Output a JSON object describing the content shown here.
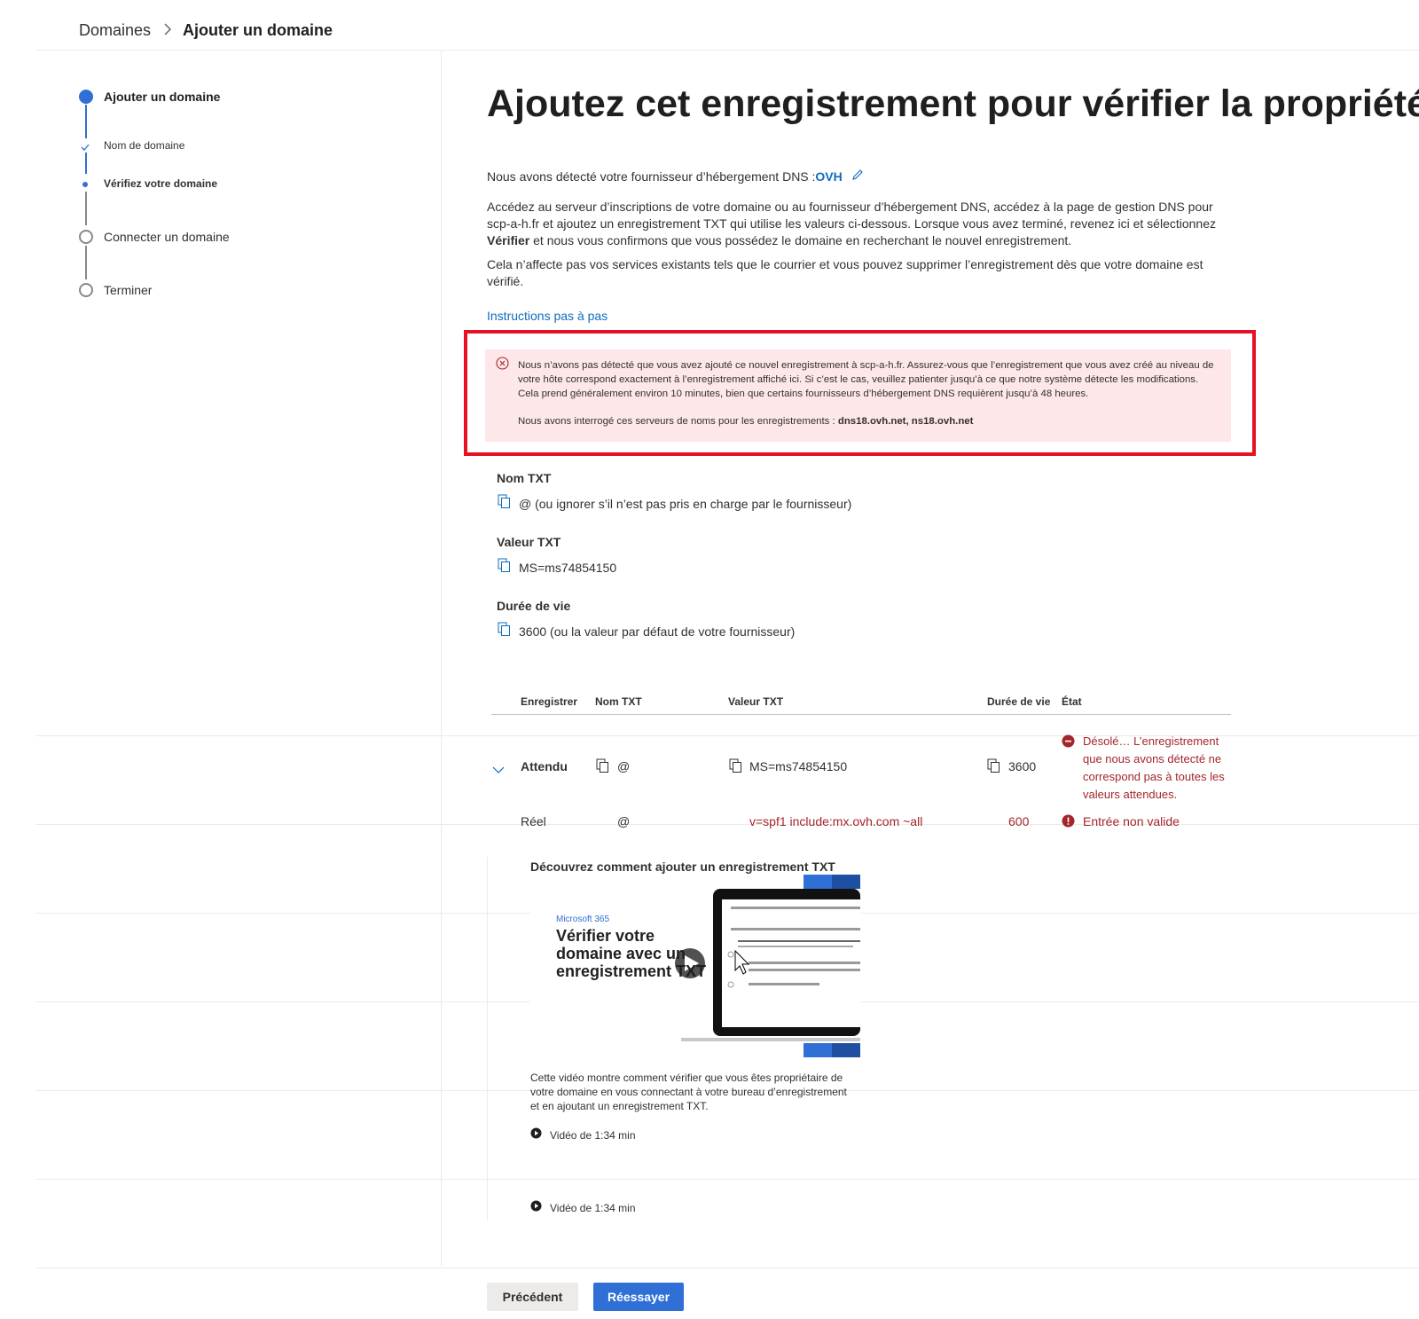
{
  "breadcrumb": {
    "root": "Domaines",
    "current": "Ajouter un domaine"
  },
  "stepper": {
    "step1": "Ajouter un domaine",
    "sub1": "Nom de domaine",
    "sub2": "Vérifiez votre domaine",
    "step2": "Connecter un domaine",
    "step3": "Terminer"
  },
  "page": {
    "title": "Ajoutez cet enregistrement pour vérifier la propriété",
    "detected_prefix": "Nous avons détecté votre fournisseur d’hébergement DNS : ",
    "provider": "OVH",
    "para1_a": "Accédez au serveur d’inscriptions de votre domaine ou au fournisseur d’hébergement DNS, accédez à la page de gestion DNS pour scp-a-h.fr et ajoutez un enregistrement TXT qui utilise les valeurs ci-dessous. Lorsque vous avez terminé, revenez ici et sélectionnez ",
    "para1_b": "Vérifier",
    "para1_c": " et nous vous confirmons que vous possédez le domaine en recherchant le nouvel enregistrement.",
    "para2": "Cela n’affecte pas vos services existants tels que le courrier et vous pouvez supprimer l’enregistrement dès que votre domaine est vérifié.",
    "instructions_link": "Instructions pas à pas"
  },
  "error": {
    "message": "Nous n’avons pas détecté que vous avez ajouté ce nouvel enregistrement à scp-a-h.fr. Assurez-vous que l’enregistrement que vous avez créé au niveau de votre hôte correspond exactement à l’enregistrement affiché ici. Si c’est le cas, veuillez patienter jusqu’à ce que notre système détecte les modifications. Cela prend généralement environ 10 minutes, bien que certains fournisseurs d’hébergement DNS requièrent jusqu’à 48 heures.",
    "servers_prefix": "Nous avons interrogé ces serveurs de noms pour les enregistrements : ",
    "servers": "dns18.ovh.net, ns18.ovh.net"
  },
  "fields": {
    "name_label": "Nom TXT",
    "name_value": "@ (ou ignorer s’il n’est pas pris en charge par le fournisseur)",
    "value_label": "Valeur TXT",
    "value_value": "MS=ms74854150",
    "ttl_label": "Durée de vie",
    "ttl_value": "3600 (ou la valeur par défaut de votre fournisseur)"
  },
  "table": {
    "headers": [
      "Enregistrer",
      "Nom TXT",
      "Valeur TXT",
      "Durée de vie",
      "État"
    ],
    "expected": {
      "label": "Attendu",
      "name": "@",
      "value": "MS=ms74854150",
      "ttl": "3600",
      "status": "Désolé… L’enregistrement que nous avons détecté ne correspond pas à toutes les valeurs attendues."
    },
    "actual": {
      "label": "Réel",
      "name": "@",
      "value": "v=spf1 include:mx.ovh.com ~all",
      "ttl": "600",
      "status": "Entrée non valide"
    }
  },
  "video": {
    "title": "Découvrez comment ajouter un enregistrement TXT",
    "thumb_brand": "Microsoft 365",
    "thumb_line1": "Vérifier votre",
    "thumb_line2": "domaine avec un",
    "thumb_line3": "enregistrement TXT",
    "description_a": "Cette vidéo montre comment vérifier que vous êtes propriétaire de",
    "description_b": "votre domaine en vous connectant à votre bureau d’enregistrement",
    "description_c": "et en ajoutant un enregistrement TXT.",
    "duration": "Vidéo de 1:34 min",
    "duration_repeat": "Vidéo de 1:34 min"
  },
  "buttons": {
    "previous": "Précédent",
    "retry": "Réessayer"
  },
  "colors": {
    "accent": "#2f6fd6",
    "error": "#a4262c",
    "error_bg": "#fde7e9",
    "highlight_frame": "#e81123"
  }
}
